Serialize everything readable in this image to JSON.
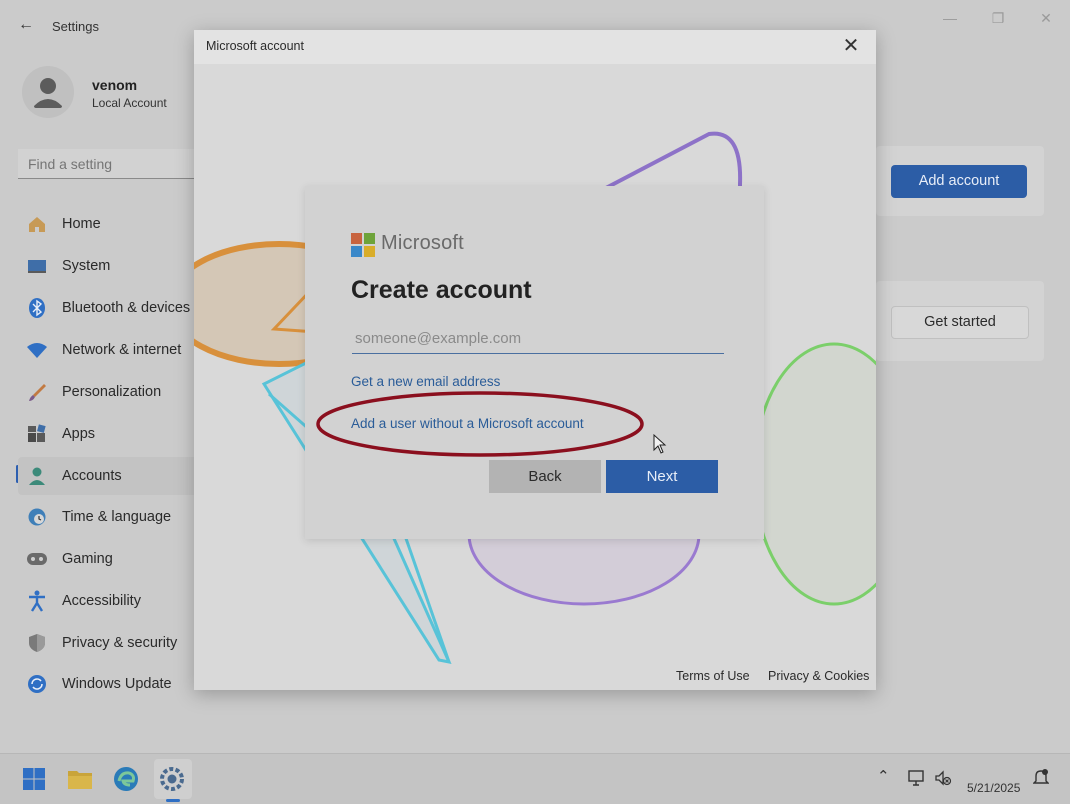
{
  "settings": {
    "title": "Settings",
    "user": {
      "name": "venom",
      "type": "Local Account"
    },
    "search_placeholder": "Find a setting",
    "nav": [
      {
        "label": "Home",
        "icon": "home-icon"
      },
      {
        "label": "System",
        "icon": "system-icon"
      },
      {
        "label": "Bluetooth & devices",
        "icon": "bluetooth-icon"
      },
      {
        "label": "Network & internet",
        "icon": "wifi-icon"
      },
      {
        "label": "Personalization",
        "icon": "brush-icon"
      },
      {
        "label": "Apps",
        "icon": "apps-icon"
      },
      {
        "label": "Accounts",
        "icon": "accounts-icon",
        "active": true
      },
      {
        "label": "Time & language",
        "icon": "globe-clock-icon"
      },
      {
        "label": "Gaming",
        "icon": "gamepad-icon"
      },
      {
        "label": "Accessibility",
        "icon": "accessibility-icon"
      },
      {
        "label": "Privacy & security",
        "icon": "shield-icon"
      },
      {
        "label": "Windows Update",
        "icon": "update-icon"
      }
    ],
    "add_account_label": "Add account",
    "get_started_label": "Get started"
  },
  "dialog": {
    "title": "Microsoft account",
    "brand": "Microsoft",
    "heading": "Create account",
    "email_placeholder": "someone@example.com",
    "email_value": "",
    "get_new_email_link": "Get a new email address",
    "no_ms_account_link": "Add a user without a Microsoft account",
    "back_label": "Back",
    "next_label": "Next",
    "terms_label": "Terms of Use",
    "privacy_label": "Privacy & Cookies"
  },
  "annotation": {
    "color": "#8b0f1e"
  },
  "taskbar": {
    "date": "5/21/2025",
    "apps": [
      "start-icon",
      "file-explorer-icon",
      "edge-icon",
      "settings-icon"
    ]
  },
  "colors": {
    "accent": "#2c5da6",
    "link": "#2a5c98"
  }
}
